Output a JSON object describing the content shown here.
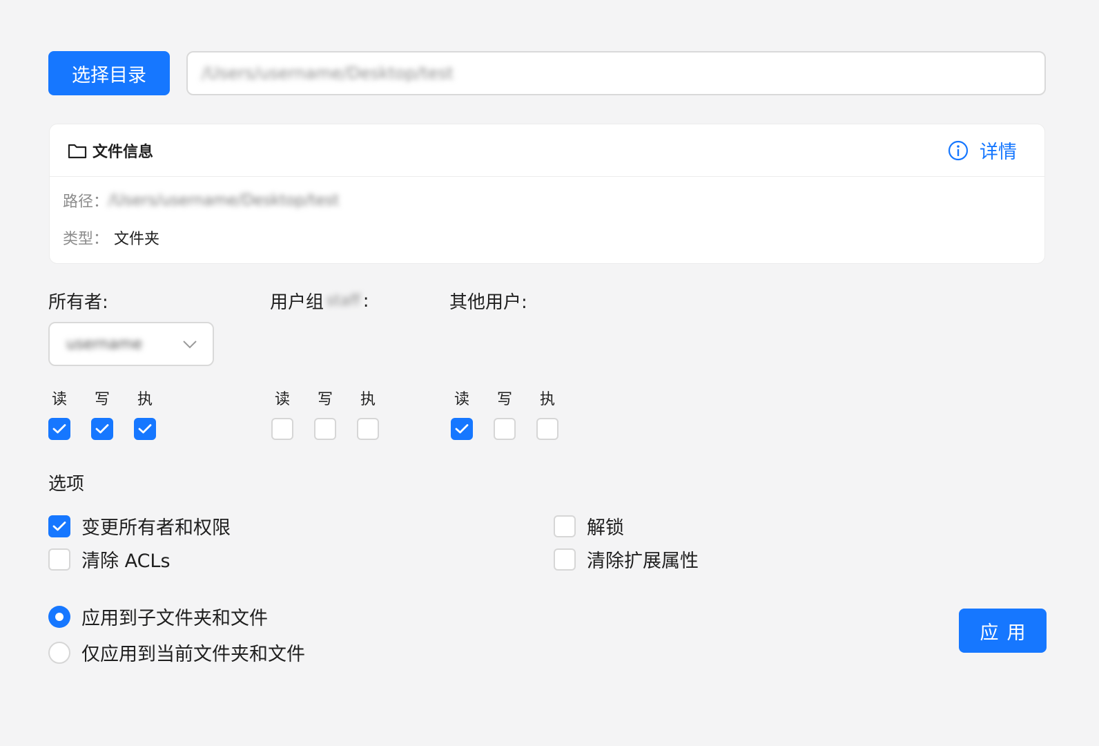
{
  "toolbar": {
    "select_dir_label": "选择目录",
    "path_value": "/Users/username/Desktop/test"
  },
  "info_card": {
    "title": "文件信息",
    "details_label": "详情",
    "path_label": "路径：",
    "path_value": "/Users/username/Desktop/test",
    "type_label": "类型：",
    "type_value": "文件夹"
  },
  "permissions": {
    "owner": {
      "title": "所有者:",
      "selected_user": "username",
      "labels": [
        "读",
        "写",
        "执"
      ],
      "checked": [
        true,
        true,
        true
      ]
    },
    "group": {
      "title_prefix": "用户组",
      "group_name": "staff",
      "title_suffix": ":",
      "labels": [
        "读",
        "写",
        "执"
      ],
      "checked": [
        false,
        false,
        false
      ]
    },
    "others": {
      "title": "其他用户:",
      "labels": [
        "读",
        "写",
        "执"
      ],
      "checked": [
        true,
        false,
        false
      ]
    }
  },
  "options": {
    "title": "选项",
    "items": [
      {
        "label": "变更所有者和权限",
        "checked": true
      },
      {
        "label": "解锁",
        "checked": false
      },
      {
        "label": "清除 ACLs",
        "checked": false
      },
      {
        "label": "清除扩展属性",
        "checked": false
      }
    ]
  },
  "apply_scope": {
    "items": [
      {
        "label": "应用到子文件夹和文件",
        "selected": true
      },
      {
        "label": "仅应用到当前文件夹和文件",
        "selected": false
      }
    ]
  },
  "apply_button_label": "应用",
  "colors": {
    "accent": "#1677ff",
    "background": "#f4f4f5"
  }
}
